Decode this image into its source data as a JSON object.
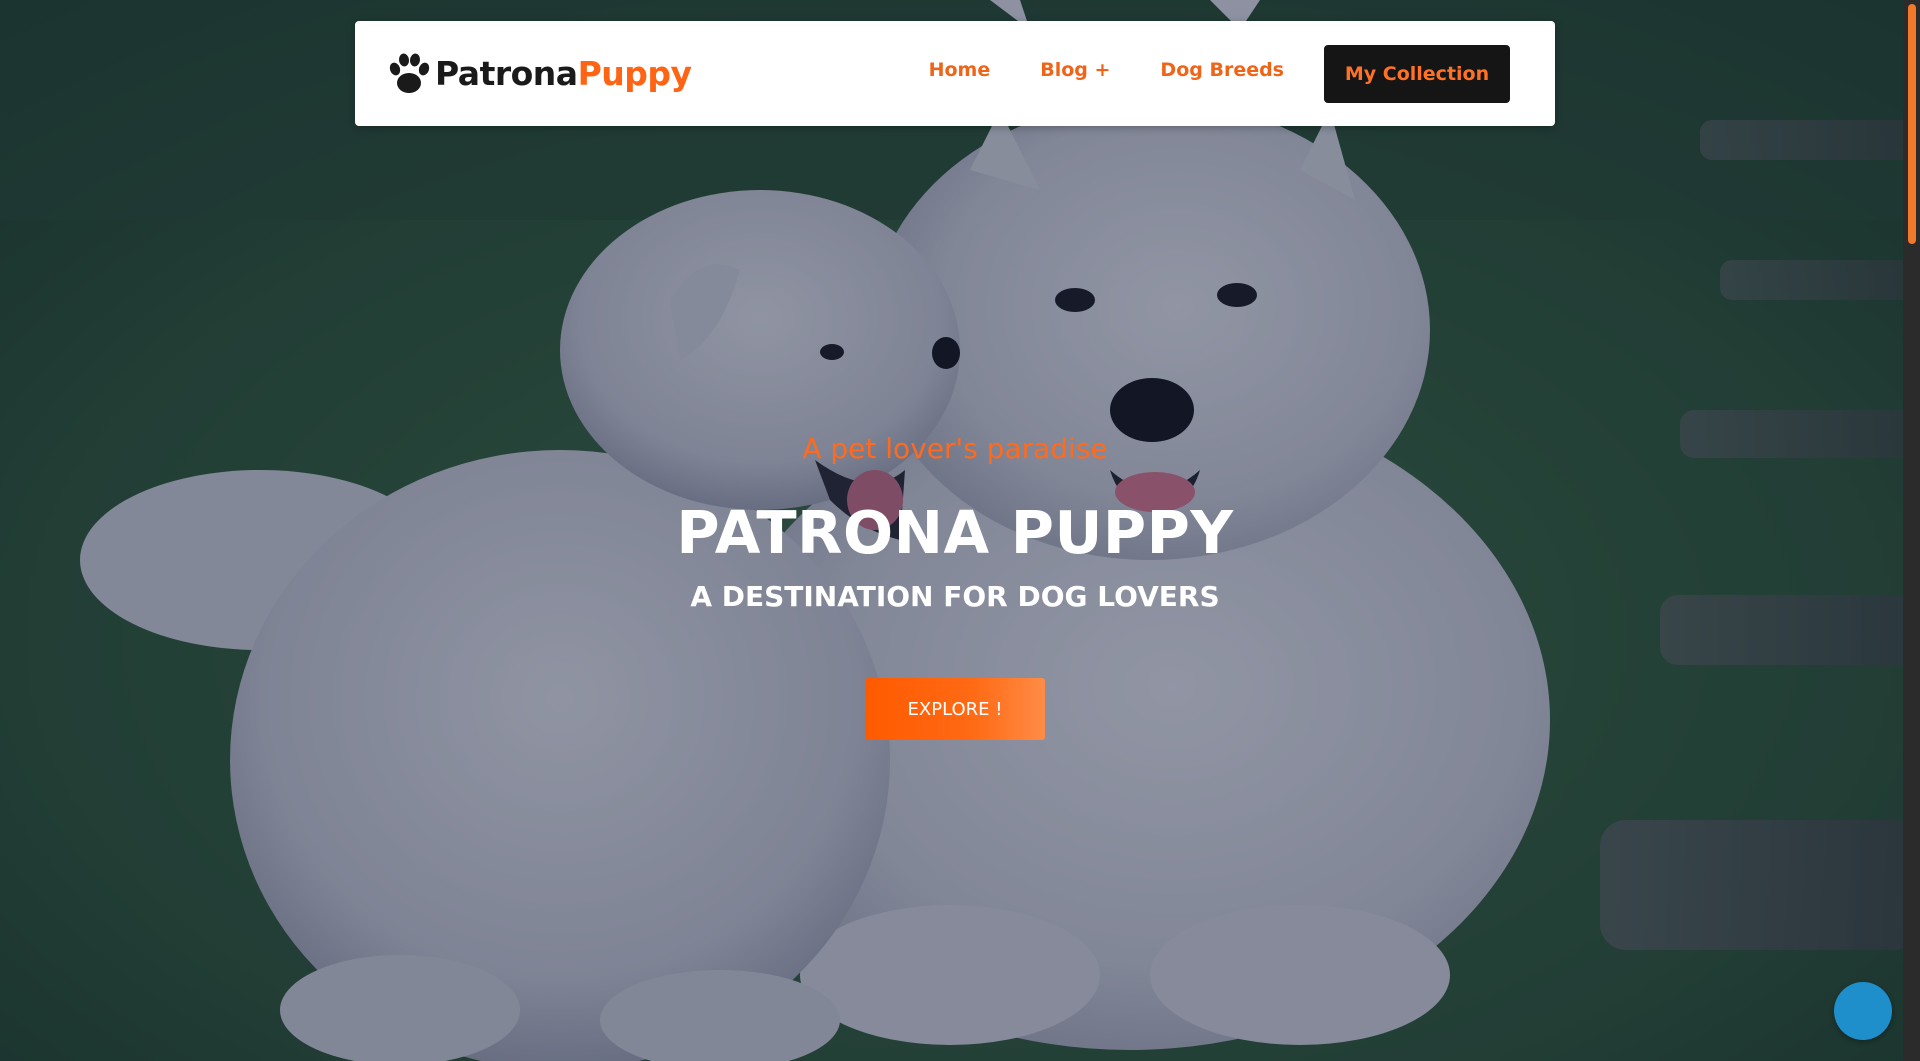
{
  "brand": {
    "name_part1": "Patrona",
    "name_part2": "Puppy",
    "icon": "paw-icon"
  },
  "nav": {
    "items": [
      {
        "label": "Home"
      },
      {
        "label": "Blog +"
      },
      {
        "label": "Dog Breeds"
      }
    ],
    "cta_label": "My Collection"
  },
  "hero": {
    "tagline": "A pet lover's paradise",
    "title": "PATRONA PUPPY",
    "subtitle": "A DESTINATION FOR DOG LOVERS",
    "button_label": "EXPLORE !",
    "background_image": "two white Samoyed dogs on grass"
  },
  "colors": {
    "accent": "#ff6414",
    "nav_text": "#f06418",
    "cta_bg": "#151515",
    "chat_bubble": "#1f8fcb"
  },
  "widgets": {
    "chat_icon": "chat-bubble-icon"
  }
}
